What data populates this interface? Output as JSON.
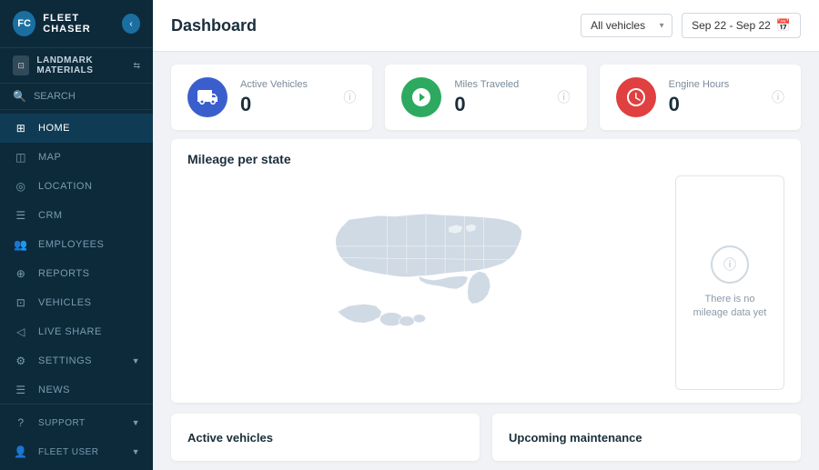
{
  "app": {
    "name": "FLEET CHASER"
  },
  "org": {
    "name": "LANDMARK MATERIALS"
  },
  "sidebar": {
    "search_label": "SEARCH",
    "items": [
      {
        "id": "home",
        "label": "HOME",
        "icon": "⊞",
        "active": true
      },
      {
        "id": "map",
        "label": "MAP",
        "icon": "⊡"
      },
      {
        "id": "location",
        "label": "LOCATION",
        "icon": "◎"
      },
      {
        "id": "crm",
        "label": "CRM",
        "icon": "☰"
      },
      {
        "id": "employees",
        "label": "EMPLOYEES",
        "icon": "👥"
      },
      {
        "id": "reports",
        "label": "REPORTS",
        "icon": "⊕"
      },
      {
        "id": "vehicles",
        "label": "VEHICLES",
        "icon": "⊡"
      },
      {
        "id": "live-share",
        "label": "LIVE SHARE",
        "icon": "◁"
      },
      {
        "id": "settings",
        "label": "SETTINGS",
        "icon": "⚙",
        "has_arrow": true
      },
      {
        "id": "news",
        "label": "NEWS",
        "icon": "☰"
      }
    ],
    "bottom": [
      {
        "id": "support",
        "label": "SUPPORT",
        "icon": "?",
        "has_arrow": true
      },
      {
        "id": "fleet-user",
        "label": "FLEET USER",
        "icon": "👤",
        "has_arrow": true
      }
    ]
  },
  "header": {
    "title": "Dashboard",
    "vehicles_select": "All vehicles",
    "date_range": "Sep 22 - Sep 22"
  },
  "stats": [
    {
      "id": "active-vehicles",
      "label": "Active Vehicles",
      "value": "0",
      "color": "blue",
      "icon": "🚚"
    },
    {
      "id": "miles-traveled",
      "label": "Miles Traveled",
      "value": "0",
      "color": "green",
      "icon": "🔵"
    },
    {
      "id": "engine-hours",
      "label": "Engine Hours",
      "value": "0",
      "color": "red",
      "icon": "⚙"
    }
  ],
  "map_section": {
    "title": "Mileage per state",
    "no_data_text": "There is no mileage data yet"
  },
  "bottom_sections": [
    {
      "id": "active-vehicles",
      "label": "Active vehicles"
    },
    {
      "id": "upcoming-maintenance",
      "label": "Upcoming maintenance"
    }
  ]
}
